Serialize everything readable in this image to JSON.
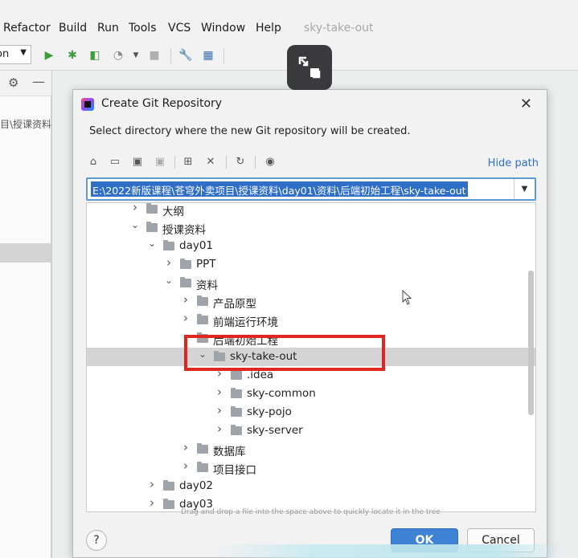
{
  "menubar": {
    "items": [
      {
        "label": "Refactor",
        "mnemonic": "R",
        "rest": "efactor"
      },
      {
        "label": "Build",
        "mnemonic": "B",
        "rest": "uild"
      },
      {
        "label": "Run",
        "mnemonic": "u",
        "pre": "R",
        "rest": "n"
      },
      {
        "label": "Tools",
        "mnemonic": "T",
        "rest": "ools"
      },
      {
        "label": "VCS",
        "mnemonic": "S",
        "pre": "VC",
        "rest": ""
      },
      {
        "label": "Window",
        "mnemonic": "W",
        "rest": "indow"
      },
      {
        "label": "Help",
        "mnemonic": "H",
        "rest": "elp"
      }
    ],
    "project_title": "sky-take-out"
  },
  "toolbar": {
    "run_config_value": "on",
    "icons": [
      "run-icon",
      "debug-icon",
      "coverage-icon",
      "profile-icon",
      "more-run-icon",
      "stop-icon",
      "wrench-icon",
      "project-structure-icon"
    ]
  },
  "side_panel": {
    "path_text": "目\\授课资料"
  },
  "dialog": {
    "title": "Create Git Repository",
    "description": "Select directory where the new Git repository will be created.",
    "hide_path_label": "Hide path",
    "path_value": "E:\\2022新版课程\\苍穹外卖项目\\授课资料\\day01\\资料\\后端初始工程\\sky-take-out",
    "drag_hint": "Drag and drop a file into the space above to quickly locate it in the tree",
    "ok_label": "OK",
    "cancel_label": "Cancel",
    "help_label": "?",
    "close_label": "✕",
    "tree": [
      {
        "label": "大纲",
        "arrow": "›",
        "level": 2
      },
      {
        "label": "授课资料",
        "arrow": "⌄",
        "level": 2
      },
      {
        "label": "day01",
        "arrow": "⌄",
        "level": 3
      },
      {
        "label": "PPT",
        "arrow": "›",
        "level": 4
      },
      {
        "label": "资料",
        "arrow": "⌄",
        "level": 4
      },
      {
        "label": "产品原型",
        "arrow": "›",
        "level": 5
      },
      {
        "label": "前端运行环境",
        "arrow": "›",
        "level": 5
      },
      {
        "label": "后端初始工程",
        "arrow": "⌄",
        "level": 5
      },
      {
        "label": "sky-take-out",
        "arrow": "⌄",
        "level": 6,
        "selected": true
      },
      {
        "label": ".idea",
        "arrow": "›",
        "level": 7
      },
      {
        "label": "sky-common",
        "arrow": "›",
        "level": 7
      },
      {
        "label": "sky-pojo",
        "arrow": "›",
        "level": 7
      },
      {
        "label": "sky-server",
        "arrow": "›",
        "level": 7
      },
      {
        "label": "数据库",
        "arrow": "›",
        "level": 5
      },
      {
        "label": "项目接口",
        "arrow": "›",
        "level": 5
      },
      {
        "label": "day02",
        "arrow": "›",
        "level": 3
      },
      {
        "label": "day03",
        "arrow": "›",
        "level": 3
      }
    ]
  },
  "colors": {
    "accent": "#3d82d5",
    "link": "#2f6fd1",
    "highlight_box": "#e1251f",
    "selection": "#2f6fc9"
  }
}
